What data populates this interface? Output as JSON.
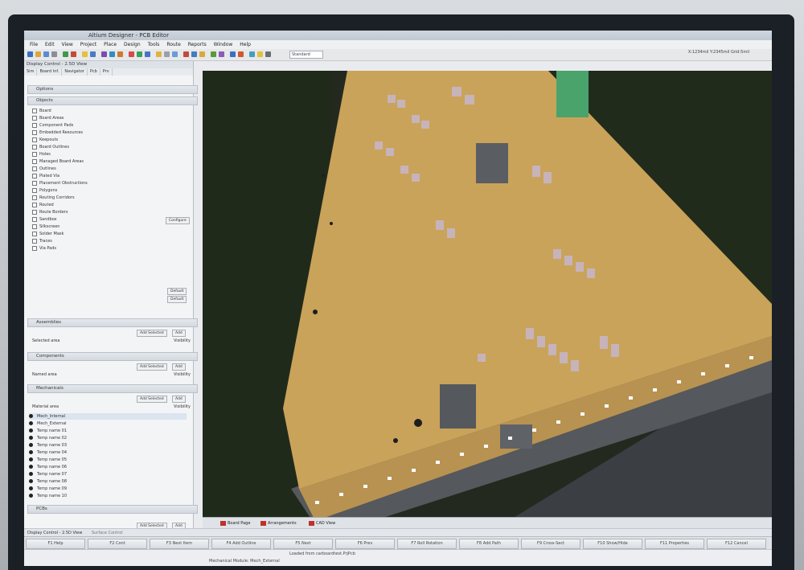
{
  "window": {
    "title": "Altium Designer - PCB Editor"
  },
  "menu": [
    "File",
    "Edit",
    "View",
    "Project",
    "Place",
    "Design",
    "Tools",
    "Route",
    "Reports",
    "Window",
    "Help"
  ],
  "toolbar": {
    "view_select": "Standard",
    "coords": "X:1234mil Y:2345mil Grid:5mil"
  },
  "panel": {
    "title": "Display Control - 2.5D View",
    "tabs": [
      "Sim",
      "Board Inf.",
      "Navigator",
      "Pcb",
      "Prv"
    ],
    "sections": {
      "options": "Options",
      "objects": "Objects",
      "assemblies": "Assemblies",
      "components": "Components",
      "mechanicals": "Mechanicals",
      "pcbs": "PCBs"
    },
    "objects": [
      "Board",
      "Board Areas",
      "Component Pads",
      "Embedded Resources",
      "Keepouts",
      "Board Outlines",
      "Holes",
      "Managed Board Areas",
      "Outlines",
      "Plated Via",
      "Placement Obstructions",
      "Polygons",
      "Routing Corridors",
      "Routed",
      "Route Borders",
      "Sandbox",
      "Silkscreen",
      "Solder Mask",
      "Traces",
      "Via Pads"
    ],
    "buttons": {
      "add_selected": "Add Selected",
      "add": "Add",
      "visibility": "Visibility",
      "default": "Default",
      "configure": "Configure"
    },
    "labels": {
      "selected_area": "Selected area",
      "named_area": "Named area",
      "material_area": "Material area"
    },
    "layers": [
      "Mech_Internal",
      "Mech_External",
      "Temp name 01",
      "Temp name 02",
      "Temp name 03",
      "Temp name 04",
      "Temp name 05",
      "Temp name 06",
      "Temp name 07",
      "Temp name 08",
      "Temp name 09",
      "Temp name 10"
    ]
  },
  "doc_tabs": [
    "Board Page",
    "Arrangements",
    "CAD View"
  ],
  "display_control": {
    "left": "Display Control - 2.5D View",
    "right": "Surface Control"
  },
  "function_keys": [
    "F1 Help",
    "F2 Cont",
    "F3 Next Item",
    "F4 Add Outline",
    "F5 Next",
    "F6 Prev",
    "F7 Roll Rotation",
    "F8 Add Path",
    "F9 Cross-Sect",
    "F10 Show/Hide",
    "F11 Properties",
    "F12 Cancel"
  ],
  "status": {
    "main": "Mechanical Module: Mech_External",
    "loaded": "Loaded from carboardtest.PrjPcb"
  }
}
